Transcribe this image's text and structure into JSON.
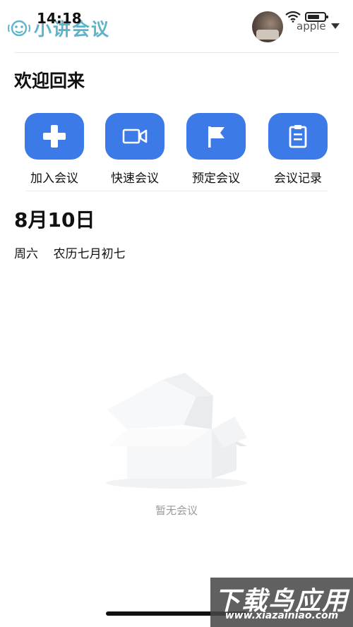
{
  "status_bar": {
    "time": "14:18"
  },
  "header": {
    "app_name": "小讲会议",
    "account_name": "apple"
  },
  "welcome": "欢迎回来",
  "actions": [
    {
      "label": "加入会议",
      "icon": "plus-icon"
    },
    {
      "label": "快速会议",
      "icon": "video-camera-icon"
    },
    {
      "label": "预定会议",
      "icon": "flag-icon"
    },
    {
      "label": "会议记录",
      "icon": "clipboard-icon"
    }
  ],
  "calendar": {
    "date": "8月10日",
    "lunar": "周六    农历七月初七"
  },
  "empty_state": {
    "text": "暂无会议"
  },
  "watermark": {
    "main": "下载鸟应用",
    "sub": "www.xiazainiao.com"
  },
  "colors": {
    "accent": "#3b7ae7",
    "logo": "#5fb3c9"
  }
}
